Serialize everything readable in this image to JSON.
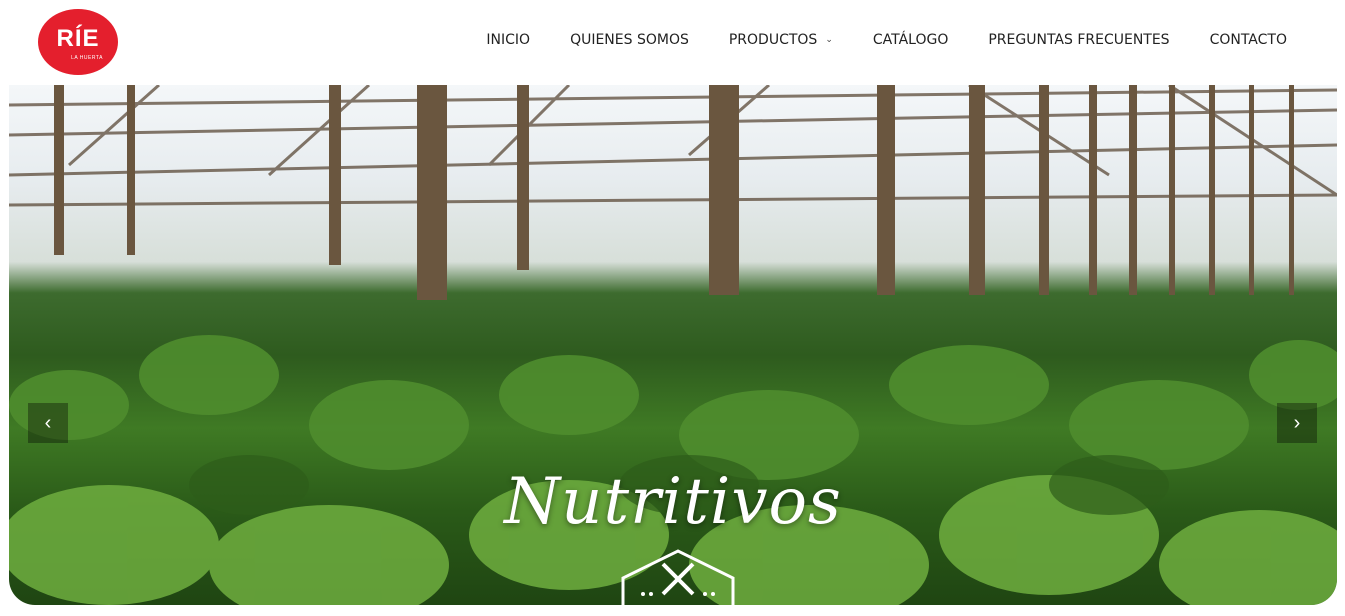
{
  "logo": {
    "text": "RÍE",
    "subtext": "LA HUERTA",
    "color": "#e41f2d"
  },
  "nav": {
    "items": [
      {
        "label": "INICIO"
      },
      {
        "label": "QUIENES SOMOS"
      },
      {
        "label": "PRODUCTOS",
        "has_dropdown": true
      },
      {
        "label": "CATÁLOGO"
      },
      {
        "label": "PREGUNTAS FRECUENTES"
      },
      {
        "label": "CONTACTO"
      }
    ],
    "dropdown_icon": "chevron-down-icon"
  },
  "hero": {
    "title": "Nutritivos",
    "prev_icon": "chevron-left-icon",
    "next_icon": "chevron-right-icon",
    "badge_icon": "greenhouse-tools-icon"
  }
}
